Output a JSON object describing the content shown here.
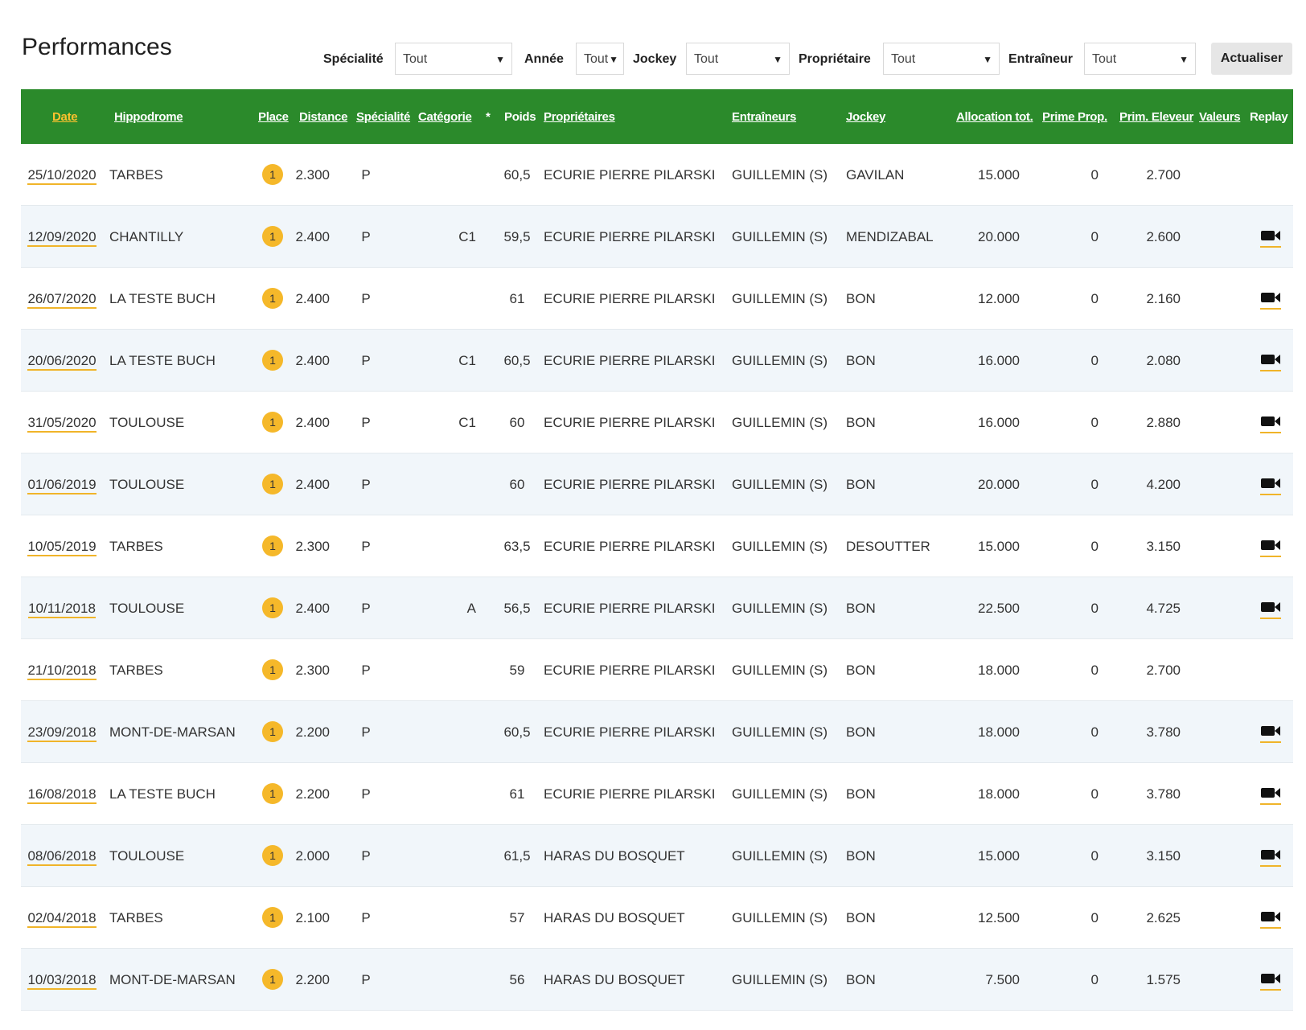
{
  "page": {
    "title": "Performances"
  },
  "filters": {
    "specialite": {
      "label": "Spécialité",
      "value": "Tout"
    },
    "annee": {
      "label": "Année",
      "value": "Tout"
    },
    "jockey": {
      "label": "Jockey",
      "value": "Tout"
    },
    "proprietaire": {
      "label": "Propriétaire",
      "value": "Tout"
    },
    "entraineur": {
      "label": "Entraîneur",
      "value": "Tout"
    },
    "refresh_label": "Actualiser"
  },
  "columns": {
    "date": "Date",
    "hippodrome": "Hippodrome",
    "place": "Place",
    "distance": "Distance",
    "specialite": "Spécialité",
    "categorie": "Catégorie",
    "star": "*",
    "poids": "Poids",
    "proprietaires": "Propriétaires",
    "entraineurs": "Entraîneurs",
    "jockey": "Jockey",
    "allocation": "Allocation tot.",
    "prime_prop": "Prime Prop.",
    "prim_eleveur": "Prim. Eleveur",
    "valeurs": "Valeurs",
    "replay": "Replay"
  },
  "colors": {
    "header_bg": "#2b8a2b",
    "active_sort": "#ffc22e",
    "badge": "#f5b82a",
    "alt_row": "#f1f6fa"
  },
  "icons": {
    "replay": "video-camera-icon",
    "dropdown": "caret-down-icon"
  },
  "rows": [
    {
      "date": "25/10/2020",
      "hippodrome": "TARBES",
      "place": "1",
      "distance": "2.300",
      "specialite": "P",
      "categorie": "",
      "poids": "60,5",
      "proprietaire": "ECURIE PIERRE PILARSKI",
      "entraineur": "GUILLEMIN (S)",
      "jockey": "GAVILAN",
      "allocation": "15.000",
      "prime_prop": "0",
      "prim_eleveur": "2.700",
      "replay": false
    },
    {
      "date": "12/09/2020",
      "hippodrome": "CHANTILLY",
      "place": "1",
      "distance": "2.400",
      "specialite": "P",
      "categorie": "C1",
      "poids": "59,5",
      "proprietaire": "ECURIE PIERRE PILARSKI",
      "entraineur": "GUILLEMIN (S)",
      "jockey": "MENDIZABAL",
      "allocation": "20.000",
      "prime_prop": "0",
      "prim_eleveur": "2.600",
      "replay": true
    },
    {
      "date": "26/07/2020",
      "hippodrome": "LA TESTE BUCH",
      "place": "1",
      "distance": "2.400",
      "specialite": "P",
      "categorie": "",
      "poids": "61",
      "proprietaire": "ECURIE PIERRE PILARSKI",
      "entraineur": "GUILLEMIN (S)",
      "jockey": "BON",
      "allocation": "12.000",
      "prime_prop": "0",
      "prim_eleveur": "2.160",
      "replay": true
    },
    {
      "date": "20/06/2020",
      "hippodrome": "LA TESTE BUCH",
      "place": "1",
      "distance": "2.400",
      "specialite": "P",
      "categorie": "C1",
      "poids": "60,5",
      "proprietaire": "ECURIE PIERRE PILARSKI",
      "entraineur": "GUILLEMIN (S)",
      "jockey": "BON",
      "allocation": "16.000",
      "prime_prop": "0",
      "prim_eleveur": "2.080",
      "replay": true
    },
    {
      "date": "31/05/2020",
      "hippodrome": "TOULOUSE",
      "place": "1",
      "distance": "2.400",
      "specialite": "P",
      "categorie": "C1",
      "poids": "60",
      "proprietaire": "ECURIE PIERRE PILARSKI",
      "entraineur": "GUILLEMIN (S)",
      "jockey": "BON",
      "allocation": "16.000",
      "prime_prop": "0",
      "prim_eleveur": "2.880",
      "replay": true
    },
    {
      "date": "01/06/2019",
      "hippodrome": "TOULOUSE",
      "place": "1",
      "distance": "2.400",
      "specialite": "P",
      "categorie": "",
      "poids": "60",
      "proprietaire": "ECURIE PIERRE PILARSKI",
      "entraineur": "GUILLEMIN (S)",
      "jockey": "BON",
      "allocation": "20.000",
      "prime_prop": "0",
      "prim_eleveur": "4.200",
      "replay": true
    },
    {
      "date": "10/05/2019",
      "hippodrome": "TARBES",
      "place": "1",
      "distance": "2.300",
      "specialite": "P",
      "categorie": "",
      "poids": "63,5",
      "proprietaire": "ECURIE PIERRE PILARSKI",
      "entraineur": "GUILLEMIN (S)",
      "jockey": "DESOUTTER",
      "allocation": "15.000",
      "prime_prop": "0",
      "prim_eleveur": "3.150",
      "replay": true
    },
    {
      "date": "10/11/2018",
      "hippodrome": "TOULOUSE",
      "place": "1",
      "distance": "2.400",
      "specialite": "P",
      "categorie": "A",
      "poids": "56,5",
      "proprietaire": "ECURIE PIERRE PILARSKI",
      "entraineur": "GUILLEMIN (S)",
      "jockey": "BON",
      "allocation": "22.500",
      "prime_prop": "0",
      "prim_eleveur": "4.725",
      "replay": true
    },
    {
      "date": "21/10/2018",
      "hippodrome": "TARBES",
      "place": "1",
      "distance": "2.300",
      "specialite": "P",
      "categorie": "",
      "poids": "59",
      "proprietaire": "ECURIE PIERRE PILARSKI",
      "entraineur": "GUILLEMIN (S)",
      "jockey": "BON",
      "allocation": "18.000",
      "prime_prop": "0",
      "prim_eleveur": "2.700",
      "replay": false
    },
    {
      "date": "23/09/2018",
      "hippodrome": "MONT-DE-MARSAN",
      "place": "1",
      "distance": "2.200",
      "specialite": "P",
      "categorie": "",
      "poids": "60,5",
      "proprietaire": "ECURIE PIERRE PILARSKI",
      "entraineur": "GUILLEMIN (S)",
      "jockey": "BON",
      "allocation": "18.000",
      "prime_prop": "0",
      "prim_eleveur": "3.780",
      "replay": true
    },
    {
      "date": "16/08/2018",
      "hippodrome": "LA TESTE BUCH",
      "place": "1",
      "distance": "2.200",
      "specialite": "P",
      "categorie": "",
      "poids": "61",
      "proprietaire": "ECURIE PIERRE PILARSKI",
      "entraineur": "GUILLEMIN (S)",
      "jockey": "BON",
      "allocation": "18.000",
      "prime_prop": "0",
      "prim_eleveur": "3.780",
      "replay": true
    },
    {
      "date": "08/06/2018",
      "hippodrome": "TOULOUSE",
      "place": "1",
      "distance": "2.000",
      "specialite": "P",
      "categorie": "",
      "poids": "61,5",
      "proprietaire": "HARAS DU BOSQUET",
      "entraineur": "GUILLEMIN (S)",
      "jockey": "BON",
      "allocation": "15.000",
      "prime_prop": "0",
      "prim_eleveur": "3.150",
      "replay": true
    },
    {
      "date": "02/04/2018",
      "hippodrome": "TARBES",
      "place": "1",
      "distance": "2.100",
      "specialite": "P",
      "categorie": "",
      "poids": "57",
      "proprietaire": "HARAS DU BOSQUET",
      "entraineur": "GUILLEMIN (S)",
      "jockey": "BON",
      "allocation": "12.500",
      "prime_prop": "0",
      "prim_eleveur": "2.625",
      "replay": true
    },
    {
      "date": "10/03/2018",
      "hippodrome": "MONT-DE-MARSAN",
      "place": "1",
      "distance": "2.200",
      "specialite": "P",
      "categorie": "",
      "poids": "56",
      "proprietaire": "HARAS DU BOSQUET",
      "entraineur": "GUILLEMIN (S)",
      "jockey": "BON",
      "allocation": "7.500",
      "prime_prop": "0",
      "prim_eleveur": "1.575",
      "replay": true
    }
  ]
}
